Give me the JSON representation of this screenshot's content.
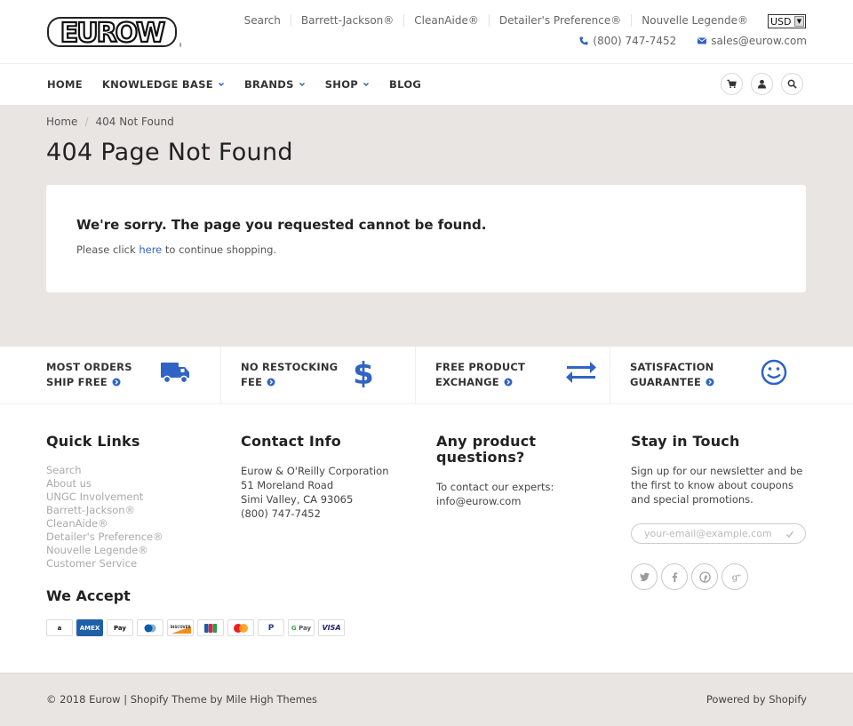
{
  "header": {
    "logo_text": "EUROW",
    "util_links": [
      "Search",
      "Barrett-Jackson®",
      "CleanAide®",
      "Detailer's Preference®",
      "Nouvelle Legende®"
    ],
    "currency": "USD",
    "phone": "(800) 747-7452",
    "email": "sales@eurow.com"
  },
  "nav": {
    "items": [
      {
        "label": "HOME",
        "dropdown": false
      },
      {
        "label": "KNOWLEDGE BASE",
        "dropdown": true
      },
      {
        "label": "BRANDS",
        "dropdown": true
      },
      {
        "label": "SHOP",
        "dropdown": true
      },
      {
        "label": "BLOG",
        "dropdown": false
      }
    ],
    "icons": [
      "cart-icon",
      "user-icon",
      "search-icon"
    ]
  },
  "breadcrumb": [
    "Home",
    "404 Not Found"
  ],
  "page_title": "404 Page Not Found",
  "card": {
    "heading": "We're sorry. The page you requested cannot be found.",
    "text_before": "Please click ",
    "link": "here",
    "text_after": " to continue shopping."
  },
  "features": [
    {
      "line1": "MOST ORDERS",
      "line2": "SHIP FREE",
      "icon": "truck-icon"
    },
    {
      "line1": "NO RESTOCKING",
      "line2": "FEE",
      "icon": "dollar-icon"
    },
    {
      "line1": "FREE PRODUCT",
      "line2": "EXCHANGE",
      "icon": "exchange-icon"
    },
    {
      "line1": "SATISFACTION",
      "line2": "GUARANTEE",
      "icon": "smile-icon"
    }
  ],
  "footer": {
    "quick_links_title": "Quick Links",
    "quick_links": [
      "Search",
      "About us",
      "UNGC Involvement",
      "Barrett-Jackson®",
      "CleanAide®",
      "Detailer's Preference®",
      "Nouvelle Legende®",
      "Customer Service"
    ],
    "contact_title": "Contact Info",
    "contact_lines": [
      "Eurow & O'Reilly Corporation",
      "51 Moreland Road",
      "Simi Valley, CA 93065",
      "(800) 747-7452"
    ],
    "questions_title": "Any product questions?",
    "questions_lines": [
      "To contact our experts:",
      "info@eurow.com"
    ],
    "touch_title": "Stay in Touch",
    "touch_text": "Sign up for our newsletter and be the first to know about coupons and special promotions.",
    "email_placeholder": "your-email@example.com",
    "we_accept": "We Accept",
    "payments": [
      "amazon",
      "AMEX",
      "Apple Pay",
      "diners",
      "discover",
      "JCB",
      "mastercard",
      "paypal",
      "G Pay",
      "VISA"
    ],
    "socials": [
      "twitter-icon",
      "facebook-icon",
      "pinterest-icon",
      "google-plus-icon"
    ]
  },
  "bottom": {
    "copyright": "© 2018 Eurow | Shopify Theme by Mile High Themes",
    "powered": "Powered by Shopify"
  },
  "colors": {
    "accent": "#2f64c4",
    "background": "#e8e5e2"
  }
}
